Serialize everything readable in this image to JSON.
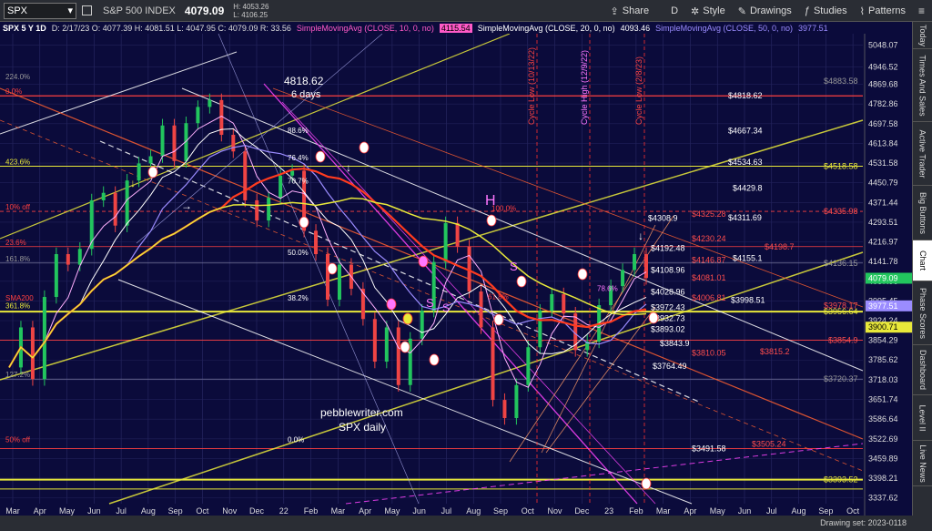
{
  "toolbar": {
    "symbol": "SPX",
    "name": "S&P 500 INDEX",
    "price": "4079.09",
    "high": "H: 4053.26",
    "low": "L: 4106.25",
    "share": "Share",
    "interval": "D",
    "style": "Style",
    "drawings": "Drawings",
    "studies": "Studies",
    "patterns": "Patterns"
  },
  "legend": {
    "symbol": "SPX 5 Y 1D",
    "ohlc": "D: 2/17/23  O: 4077.39  H: 4081.51  L: 4047.95  C: 4079.09  R: 33.56",
    "sma10": "SimpleMovingAvg (CLOSE, 10, 0, no)",
    "sma10_val": "4115.54",
    "sma20": "SimpleMovingAvg (CLOSE, 20, 0, no)",
    "sma20_val": "4093.46",
    "sma50": "SimpleMovingAvg (CLOSE, 50, 0, no)",
    "sma50_val": "3977.51"
  },
  "sidetabs": [
    "Today",
    "Times And Sales",
    "Active Trader",
    "Big Buttons",
    "Chart",
    "Phase Scores",
    "Dashboard",
    "Level II",
    "Live News"
  ],
  "footer": {
    "drawing_set": "Drawing set: 2023-0118"
  },
  "colors": {
    "bg": "#0b0b3b",
    "price_up": "#22c55e",
    "price_down": "#ef4444",
    "sma10": "#ffb0ff",
    "sma20": "#ffffff",
    "sma50": "#9b8cff",
    "red_ma": "#ff3b1f",
    "yellow": "#e8e83a",
    "magenta": "#ff44ff"
  },
  "chart_data": {
    "type": "line",
    "title": "",
    "x_ticks": [
      "Mar",
      "Apr",
      "May",
      "Jun",
      "Jul",
      "Aug",
      "Sep",
      "Oct",
      "Nov",
      "Dec",
      "22",
      "Feb",
      "Mar",
      "Apr",
      "May",
      "Jun",
      "Jul",
      "Aug",
      "Sep",
      "Oct",
      "Nov",
      "Dec",
      "23",
      "Feb",
      "Mar",
      "Apr",
      "May",
      "Jun",
      "Jul",
      "Aug",
      "Sep",
      "Oct"
    ],
    "y_ticks": [
      "5048.07",
      "4946.52",
      "4869.68",
      "4782.86",
      "4697.58",
      "4613.84",
      "4531.58",
      "4450.79",
      "4371.44",
      "4293.51",
      "4216.97",
      "4141.78",
      "4067.96",
      "3995.45",
      "3924.24",
      "3854.29",
      "3785.62",
      "3718.03",
      "3651.74",
      "3586.64",
      "3522.69",
      "3459.89",
      "3398.21",
      "3337.62"
    ],
    "ylim": [
      3320,
      5100
    ],
    "y_scale": "log",
    "price_labels": [
      {
        "text": "4079.09",
        "value": 4079.09,
        "color": "#22c55e"
      },
      {
        "text": "3977.51",
        "value": 3977.51,
        "color": "#9b8cff"
      },
      {
        "text": "3900.71",
        "value": 3900.71,
        "color": "#e8e83a"
      }
    ],
    "annotations": [
      {
        "text": "4818.62",
        "value": 4818.62
      },
      {
        "text": "4667.34",
        "value": 4667.34
      },
      {
        "text": "4534.63",
        "value": 4534.63
      },
      {
        "text": "4518.58",
        "value": 4518.58
      },
      {
        "text": "4429.8",
        "value": 4429.8
      },
      {
        "text": "4325.28",
        "value": 4325.28
      },
      {
        "text": "4311.69",
        "value": 4311.69
      },
      {
        "text": "4308.9",
        "value": 4308.9
      },
      {
        "text": "4335.98",
        "value": 4335.98
      },
      {
        "text": "4230.24",
        "value": 4230.24
      },
      {
        "text": "4192.48",
        "value": 4192.48
      },
      {
        "text": "4198.7",
        "value": 4198.7
      },
      {
        "text": "4155.1",
        "value": 4155.1
      },
      {
        "text": "4146.87",
        "value": 4146.87
      },
      {
        "text": "4136.15",
        "value": 4136.15
      },
      {
        "text": "4108.96",
        "value": 4108.96
      },
      {
        "text": "4081.01",
        "value": 4081.01
      },
      {
        "text": "4028.96",
        "value": 4028.96
      },
      {
        "text": "4006.81",
        "value": 4006.81
      },
      {
        "text": "3998.51",
        "value": 3998.51
      },
      {
        "text": "3978.17",
        "value": 3978.17
      },
      {
        "text": "3956.64",
        "value": 3956.64
      },
      {
        "text": "3972.43",
        "value": 3972.43
      },
      {
        "text": "3932.73",
        "value": 3932.73
      },
      {
        "text": "3893.02",
        "value": 3893.02
      },
      {
        "text": "3854.9",
        "value": 3854.9
      },
      {
        "text": "3843.9",
        "value": 3843.9
      },
      {
        "text": "3815.2",
        "value": 3815.2
      },
      {
        "text": "3810.05",
        "value": 3810.05
      },
      {
        "text": "3764.49",
        "value": 3764.49
      },
      {
        "text": "3720.37",
        "value": 3720.37
      },
      {
        "text": "3505.24",
        "value": 3505.24
      },
      {
        "text": "3491.58",
        "value": 3491.58
      },
      {
        "text": "3393.52",
        "value": 3393.52
      },
      {
        "text": "4883.58",
        "value": 4883.58
      }
    ],
    "fib_labels": [
      "224.0%",
      "0.0%",
      "423.6%",
      "10% off",
      "23.6%",
      "161.8%",
      "SMA200",
      "361.8%",
      "127.2%",
      "50.0%",
      "100.0%",
      "50% off",
      "38.2%",
      "61.8%",
      "70.7%",
      "76.4%",
      "88.6%",
      "78.6%",
      "0.0%"
    ],
    "cycle_labels": [
      "Cycle Low (10/13/22)",
      "Cycle High (12/9/22)",
      "Cycle Low (2/8/23)"
    ],
    "text_annotations": [
      "4818.62",
      "6 days",
      "pebblewriter.com",
      "SPX daily",
      "H",
      "S",
      "S",
      "S"
    ],
    "series": [
      {
        "name": "SPX",
        "values": [
          3760,
          3900,
          3720,
          4010,
          4170,
          4130,
          4190,
          4380,
          4410,
          4280,
          4460,
          4530,
          4560,
          4690,
          4540,
          4700,
          4770,
          4800,
          4650,
          4580,
          4380,
          4300,
          4390,
          4480,
          4500,
          4260,
          4170,
          4000,
          4130,
          4040,
          3930,
          3780,
          3900,
          3700,
          3860,
          3960,
          4140,
          4290,
          4200,
          4030,
          3900,
          3650,
          3590,
          3700,
          3830,
          3960,
          4020,
          3950,
          3820,
          3850,
          3980,
          4050,
          4110,
          4170,
          4080
        ]
      },
      {
        "name": "SMA10",
        "values": []
      },
      {
        "name": "SMA20",
        "values": []
      },
      {
        "name": "SMA50",
        "values": []
      }
    ]
  }
}
